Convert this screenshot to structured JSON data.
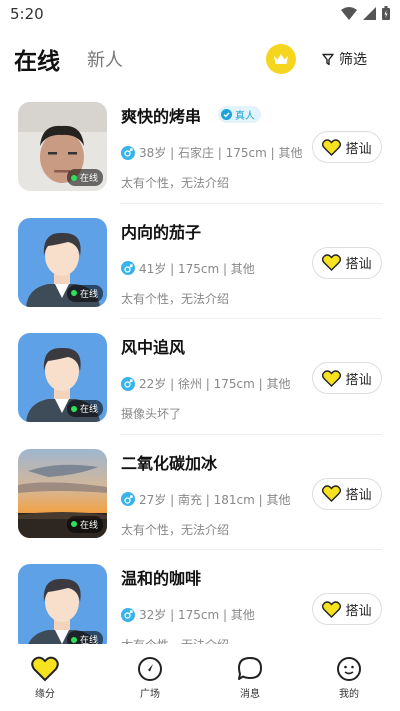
{
  "status_bar": {
    "time": "5:20"
  },
  "header": {
    "tab_online": "在线",
    "tab_new": "新人",
    "filter_label": "筛选"
  },
  "users": [
    {
      "name": "爽快的烤串",
      "verified": "真人",
      "info": "38岁 | 石家庄 | 175cm | 其他",
      "bio": "太有个性，无法介绍",
      "online": "在线",
      "chat": "搭讪",
      "avatar": "photo-man"
    },
    {
      "name": "内向的茄子",
      "verified": "",
      "info": "41岁 | 175cm | 其他",
      "bio": "太有个性，无法介绍",
      "online": "在线",
      "chat": "搭讪",
      "avatar": "default"
    },
    {
      "name": "风中追风",
      "verified": "",
      "info": "22岁 | 徐州 | 175cm | 其他",
      "bio": "摄像头坏了",
      "online": "在线",
      "chat": "搭讪",
      "avatar": "default"
    },
    {
      "name": "二氧化碳加冰",
      "verified": "",
      "info": "27岁 | 南充 | 181cm | 其他",
      "bio": "太有个性，无法介绍",
      "online": "在线",
      "chat": "搭讪",
      "avatar": "sunset"
    },
    {
      "name": "温和的咖啡",
      "verified": "",
      "info": "32岁 | 175cm | 其他",
      "bio": "太有个性，无法介绍",
      "online": "在线",
      "chat": "搭讪",
      "avatar": "default"
    }
  ],
  "bottom_nav": [
    {
      "label": "缘分",
      "icon": "heart-icon",
      "active": true
    },
    {
      "label": "广场",
      "icon": "compass-icon",
      "active": false
    },
    {
      "label": "消息",
      "icon": "message-icon",
      "active": false
    },
    {
      "label": "我的",
      "icon": "profile-icon",
      "active": false
    }
  ],
  "colors": {
    "accent": "#f6d51f",
    "verified": "#1ea3d9",
    "online": "#2ee05a"
  }
}
